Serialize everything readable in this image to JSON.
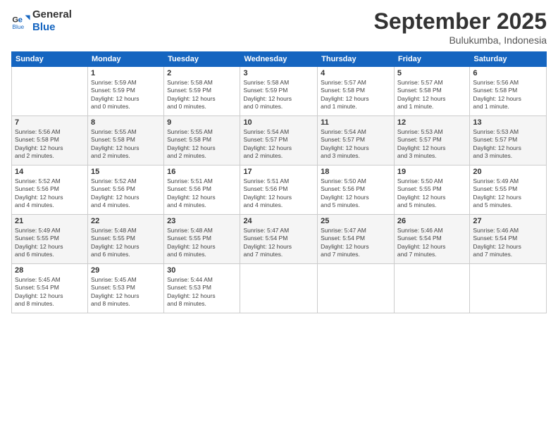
{
  "logo": {
    "line1": "General",
    "line2": "Blue"
  },
  "title": "September 2025",
  "location": "Bulukumba, Indonesia",
  "headers": [
    "Sunday",
    "Monday",
    "Tuesday",
    "Wednesday",
    "Thursday",
    "Friday",
    "Saturday"
  ],
  "weeks": [
    [
      {
        "day": "",
        "info": ""
      },
      {
        "day": "1",
        "info": "Sunrise: 5:59 AM\nSunset: 5:59 PM\nDaylight: 12 hours\nand 0 minutes."
      },
      {
        "day": "2",
        "info": "Sunrise: 5:58 AM\nSunset: 5:59 PM\nDaylight: 12 hours\nand 0 minutes."
      },
      {
        "day": "3",
        "info": "Sunrise: 5:58 AM\nSunset: 5:59 PM\nDaylight: 12 hours\nand 0 minutes."
      },
      {
        "day": "4",
        "info": "Sunrise: 5:57 AM\nSunset: 5:58 PM\nDaylight: 12 hours\nand 1 minute."
      },
      {
        "day": "5",
        "info": "Sunrise: 5:57 AM\nSunset: 5:58 PM\nDaylight: 12 hours\nand 1 minute."
      },
      {
        "day": "6",
        "info": "Sunrise: 5:56 AM\nSunset: 5:58 PM\nDaylight: 12 hours\nand 1 minute."
      }
    ],
    [
      {
        "day": "7",
        "info": "Sunrise: 5:56 AM\nSunset: 5:58 PM\nDaylight: 12 hours\nand 2 minutes."
      },
      {
        "day": "8",
        "info": "Sunrise: 5:55 AM\nSunset: 5:58 PM\nDaylight: 12 hours\nand 2 minutes."
      },
      {
        "day": "9",
        "info": "Sunrise: 5:55 AM\nSunset: 5:58 PM\nDaylight: 12 hours\nand 2 minutes."
      },
      {
        "day": "10",
        "info": "Sunrise: 5:54 AM\nSunset: 5:57 PM\nDaylight: 12 hours\nand 2 minutes."
      },
      {
        "day": "11",
        "info": "Sunrise: 5:54 AM\nSunset: 5:57 PM\nDaylight: 12 hours\nand 3 minutes."
      },
      {
        "day": "12",
        "info": "Sunrise: 5:53 AM\nSunset: 5:57 PM\nDaylight: 12 hours\nand 3 minutes."
      },
      {
        "day": "13",
        "info": "Sunrise: 5:53 AM\nSunset: 5:57 PM\nDaylight: 12 hours\nand 3 minutes."
      }
    ],
    [
      {
        "day": "14",
        "info": "Sunrise: 5:52 AM\nSunset: 5:56 PM\nDaylight: 12 hours\nand 4 minutes."
      },
      {
        "day": "15",
        "info": "Sunrise: 5:52 AM\nSunset: 5:56 PM\nDaylight: 12 hours\nand 4 minutes."
      },
      {
        "day": "16",
        "info": "Sunrise: 5:51 AM\nSunset: 5:56 PM\nDaylight: 12 hours\nand 4 minutes."
      },
      {
        "day": "17",
        "info": "Sunrise: 5:51 AM\nSunset: 5:56 PM\nDaylight: 12 hours\nand 4 minutes."
      },
      {
        "day": "18",
        "info": "Sunrise: 5:50 AM\nSunset: 5:56 PM\nDaylight: 12 hours\nand 5 minutes."
      },
      {
        "day": "19",
        "info": "Sunrise: 5:50 AM\nSunset: 5:55 PM\nDaylight: 12 hours\nand 5 minutes."
      },
      {
        "day": "20",
        "info": "Sunrise: 5:49 AM\nSunset: 5:55 PM\nDaylight: 12 hours\nand 5 minutes."
      }
    ],
    [
      {
        "day": "21",
        "info": "Sunrise: 5:49 AM\nSunset: 5:55 PM\nDaylight: 12 hours\nand 6 minutes."
      },
      {
        "day": "22",
        "info": "Sunrise: 5:48 AM\nSunset: 5:55 PM\nDaylight: 12 hours\nand 6 minutes."
      },
      {
        "day": "23",
        "info": "Sunrise: 5:48 AM\nSunset: 5:55 PM\nDaylight: 12 hours\nand 6 minutes."
      },
      {
        "day": "24",
        "info": "Sunrise: 5:47 AM\nSunset: 5:54 PM\nDaylight: 12 hours\nand 7 minutes."
      },
      {
        "day": "25",
        "info": "Sunrise: 5:47 AM\nSunset: 5:54 PM\nDaylight: 12 hours\nand 7 minutes."
      },
      {
        "day": "26",
        "info": "Sunrise: 5:46 AM\nSunset: 5:54 PM\nDaylight: 12 hours\nand 7 minutes."
      },
      {
        "day": "27",
        "info": "Sunrise: 5:46 AM\nSunset: 5:54 PM\nDaylight: 12 hours\nand 7 minutes."
      }
    ],
    [
      {
        "day": "28",
        "info": "Sunrise: 5:45 AM\nSunset: 5:54 PM\nDaylight: 12 hours\nand 8 minutes."
      },
      {
        "day": "29",
        "info": "Sunrise: 5:45 AM\nSunset: 5:53 PM\nDaylight: 12 hours\nand 8 minutes."
      },
      {
        "day": "30",
        "info": "Sunrise: 5:44 AM\nSunset: 5:53 PM\nDaylight: 12 hours\nand 8 minutes."
      },
      {
        "day": "",
        "info": ""
      },
      {
        "day": "",
        "info": ""
      },
      {
        "day": "",
        "info": ""
      },
      {
        "day": "",
        "info": ""
      }
    ]
  ]
}
